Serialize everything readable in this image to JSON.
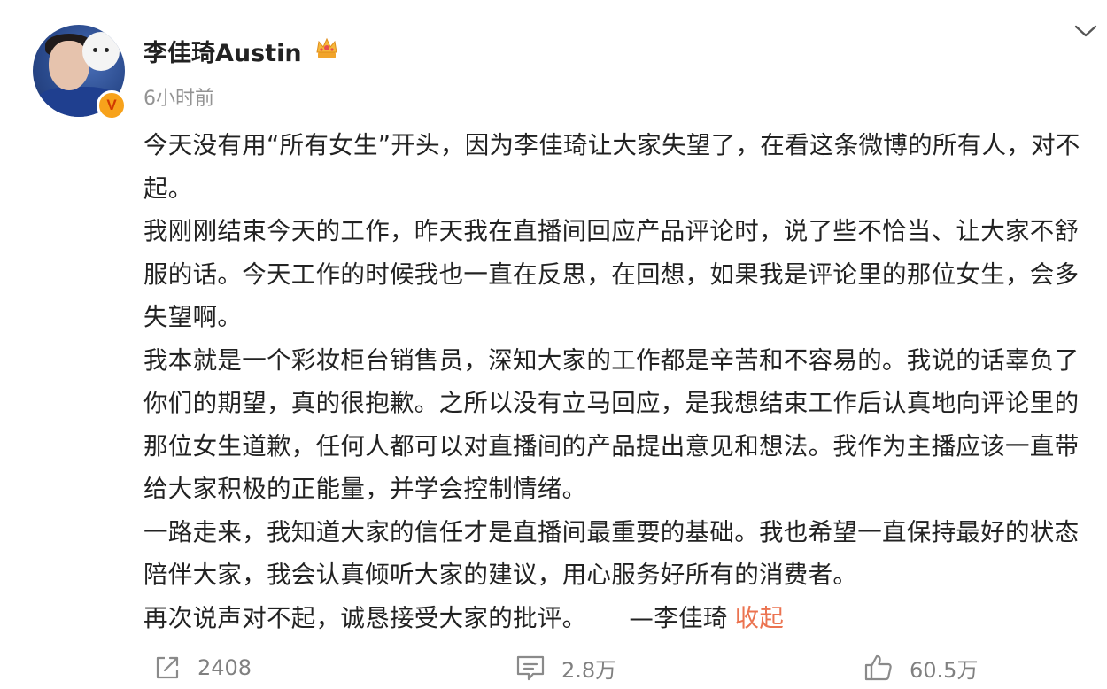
{
  "user": {
    "name": "李佳琦Austin",
    "time": "6小时前",
    "verified_mark": "V",
    "badge_icon": "crown-icon"
  },
  "post": {
    "paragraphs": [
      "今天没有用“所有女生”开头，因为李佳琦让大家失望了，在看这条微博的所有人，对不起。",
      "我刚刚结束今天的工作，昨天我在直播间回应产品评论时，说了些不恰当、让大家不舒服的话。今天工作的时候我也一直在反思，在回想，如果我是评论里的那位女生，会多失望啊。",
      "我本就是一个彩妆柜台销售员，深知大家的工作都是辛苦和不容易的。我说的话辜负了你们的期望，真的很抱歉。之所以没有立马回应，是我想结束工作后认真地向评论里的那位女生道歉，任何人都可以对直播间的产品提出意见和想法。我作为主播应该一直带给大家积极的正能量，并学会控制情绪。",
      "一路走来，我知道大家的信任才是直播间最重要的基础。我也希望一直保持最好的状态陪伴大家，我会认真倾听大家的建议，用心服务好所有的消费者。"
    ],
    "last_line": "再次说声对不起，诚恳接受大家的批评。",
    "signature": "—李佳琦",
    "collapse_label": "收起"
  },
  "actions": {
    "repost_count": "2408",
    "comment_count": "2.8万",
    "like_count": "60.5万"
  },
  "colors": {
    "text": "#222222",
    "muted": "#939393",
    "link": "#eb7350",
    "verified": "#f7a21b"
  }
}
